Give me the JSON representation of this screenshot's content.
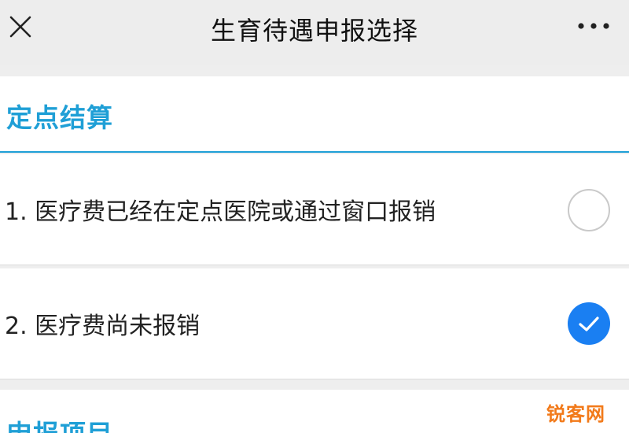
{
  "header": {
    "title": "生育待遇申报选择",
    "close_icon": "close-icon",
    "more_icon": "more-dots-icon"
  },
  "sections": [
    {
      "title": "定点结算",
      "options": [
        {
          "label": "1. 医疗费已经在定点医院或通过窗口报销",
          "selected": false
        },
        {
          "label": "2. 医疗费尚未报销",
          "selected": true
        }
      ]
    },
    {
      "title": "申报项目"
    }
  ],
  "watermark": "锐客网",
  "colors": {
    "accent": "#1f9fd6",
    "radio_selected": "#1a7ff2",
    "watermark": "#f27a1a"
  }
}
